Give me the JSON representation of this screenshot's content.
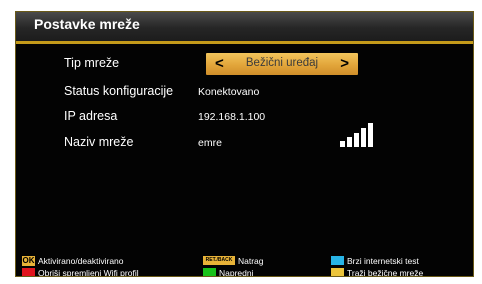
{
  "window": {
    "title": "Postavke mreže"
  },
  "settings": [
    {
      "label": "Tip mreže",
      "value": "Bežični uređaj"
    },
    {
      "label": "Status konfiguracije",
      "value": "Konektovano"
    },
    {
      "label": "IP adresa",
      "value": "192.168.1.100"
    },
    {
      "label": "Naziv mreže",
      "value": "emre"
    }
  ],
  "signal": {
    "level": 5,
    "max": 5
  },
  "legend": {
    "ok_key": "OK",
    "ok_label": "Aktivirano/deaktivirano",
    "back_key": "RET./BACK",
    "back_label": "Natrag",
    "blue_label": "Brzi internetski test",
    "red_label": "Obriši spremljeni Wifi profil",
    "green_label": "Napredni",
    "yellow_label": "Traži bežične mreže"
  },
  "colors": {
    "accent_gold": "#c49a1a",
    "selector": "#e2a53a",
    "red": "#e0141e",
    "green": "#18c21a",
    "blue": "#28b4e6",
    "yellow": "#ecc43a"
  }
}
